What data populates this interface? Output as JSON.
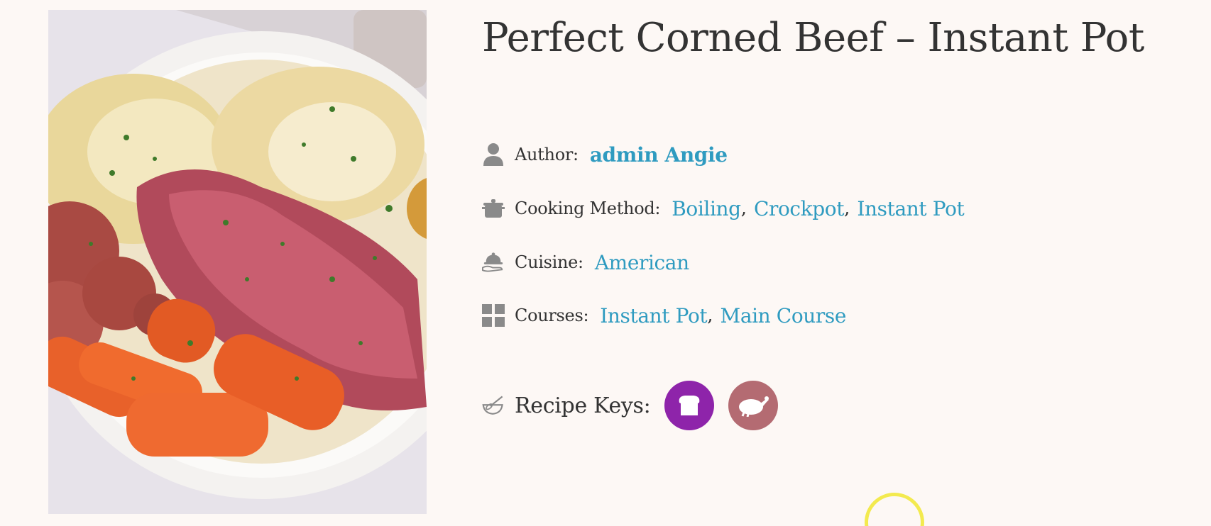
{
  "recipe": {
    "title": "Perfect Corned Beef – Instant Pot",
    "image_alt": "Corned beef with cabbage, potatoes and carrots"
  },
  "meta": {
    "author": {
      "label": "Author:",
      "value": "admin Angie",
      "icon": "person-icon"
    },
    "cooking_method": {
      "label": "Cooking Method:",
      "values": [
        "Boiling",
        "Crockpot",
        "Instant Pot"
      ],
      "icon": "pot-icon"
    },
    "cuisine": {
      "label": "Cuisine:",
      "value": "American",
      "icon": "cloche-icon"
    },
    "courses": {
      "label": "Courses:",
      "values": [
        "Instant Pot",
        "Main Course"
      ],
      "icon": "grid-icon"
    },
    "recipe_keys": {
      "label": "Recipe Keys:",
      "icon": "whisk-bowl-icon",
      "keys": [
        {
          "icon": "bread-icon",
          "color": "#8e24aa"
        },
        {
          "icon": "turkey-icon",
          "color": "#b46b72"
        }
      ]
    }
  },
  "colors": {
    "link": "#2f9bc0",
    "background": "#fdf8f5",
    "icon_gray": "#8a8a8a",
    "cursor_ring": "#f3ea4f"
  }
}
